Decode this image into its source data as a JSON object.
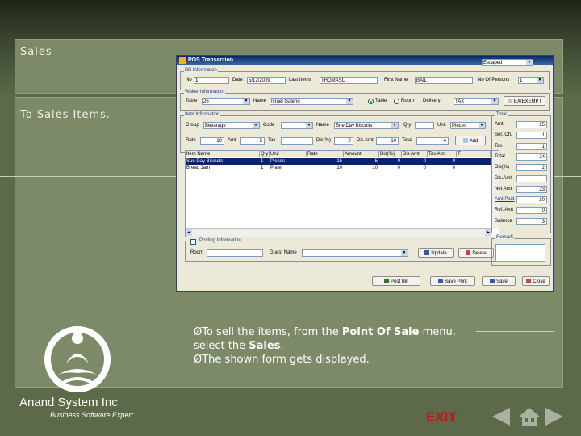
{
  "slide": {
    "title": "Sales",
    "subtitle": "To Sales Items.",
    "instruction_1_pre": "To sell the items, from the ",
    "instruction_1_bold": "Point Of Sale",
    "instruction_1_post": " menu,",
    "instruction_2_pre": "select the ",
    "instruction_2_bold": "Sales",
    "instruction_2_post": ".",
    "instruction_3": "The shown form gets displayed.",
    "bullet": "Ø",
    "company_name": "Anand System Inc",
    "company_tagline": "Business Software Expert",
    "exit_label": "EXIT",
    "nav": {
      "prev_icon": "triangle-left-icon",
      "home_icon": "home-icon",
      "next_icon": "triangle-right-icon"
    }
  },
  "window": {
    "title": "POS Transaction",
    "top_combo": "Escaped",
    "bill_group": "Bill Information",
    "no_label": "No",
    "no_value": "1",
    "date_label": "Date",
    "date_value": "5/12/2009",
    "last_items_label": "Last Items",
    "last_items_value": "THOMASO",
    "first_name_label": "First Name",
    "first_name_value": "BAIL",
    "no_of_persons_label": "No Of Persons",
    "no_of_persons_value": "1",
    "waiter_group": "Waiter Information",
    "table_label": "Table",
    "table_value": "26",
    "name_label": "Name",
    "name_value": "Israel Galeno",
    "radio_table": "Table",
    "radio_room": "Room",
    "delivery_label": "Delivery",
    "tax_value": "TAX",
    "exemptions_label": "EX/EXEMPT",
    "item_group": "Item Information",
    "group_label": "Group",
    "group_value": "Bevarage",
    "code_label": "Code",
    "code_value": "",
    "item_name_label": "Name",
    "item_name_value": "Brie Day Biscuits",
    "qty_label": "Qty",
    "qty_value": "",
    "unit_label": "Unit",
    "unit_value": "Pieces",
    "rate_label": "Rate",
    "rate_value": "10",
    "amt_label": "Amt",
    "amt_value": "5",
    "tax_label": "Tax",
    "tax_amt": "",
    "disc_pct_label": "Dis(%)",
    "disc_pct_value": "2",
    "dis_amt_label": "Dis Amt",
    "dis_amt_value": "10",
    "total_label": "Total",
    "total_value": "4",
    "add_button": "Add",
    "grid_headers": [
      "Item Name",
      "Qty",
      "Unit",
      "Rate",
      "Amount",
      "Dis(%)",
      "Dis Amt",
      "Tax Amt",
      "T"
    ],
    "grid_rows": [
      [
        "Sun Day Biscuits",
        "1",
        "Pieces",
        "15",
        "5",
        "0",
        "0",
        "0"
      ],
      [
        "Bread Jam",
        "1",
        "Plate",
        "10",
        "10",
        "0",
        "0",
        "0"
      ]
    ],
    "posting_label": "Posting Information",
    "room_label": "Room",
    "room_value": "",
    "guest_name_label": "Guest Name",
    "guest_name_value": "",
    "update_button": "Update",
    "delete_button": "Delete",
    "totals_group": "Total",
    "totals": [
      {
        "label": "Amt",
        "value": "25"
      },
      {
        "label": "Ser. Ch.",
        "value": "1"
      },
      {
        "label": "Tax",
        "value": "1"
      },
      {
        "label": "Total",
        "value": "24"
      },
      {
        "label": "Dis(%)",
        "value": "2"
      },
      {
        "label": "Dis.Amt",
        "value": ""
      },
      {
        "label": "Net Amt",
        "value": "23"
      },
      {
        "label": "Amt Paid",
        "value": "20"
      },
      {
        "label": "Ref. Amt",
        "value": "0"
      },
      {
        "label": "Balance",
        "value": "3"
      }
    ],
    "remark_label": "Remark",
    "bottom_buttons": [
      "Post Bill",
      "Save Print",
      "Save",
      "Close"
    ]
  }
}
